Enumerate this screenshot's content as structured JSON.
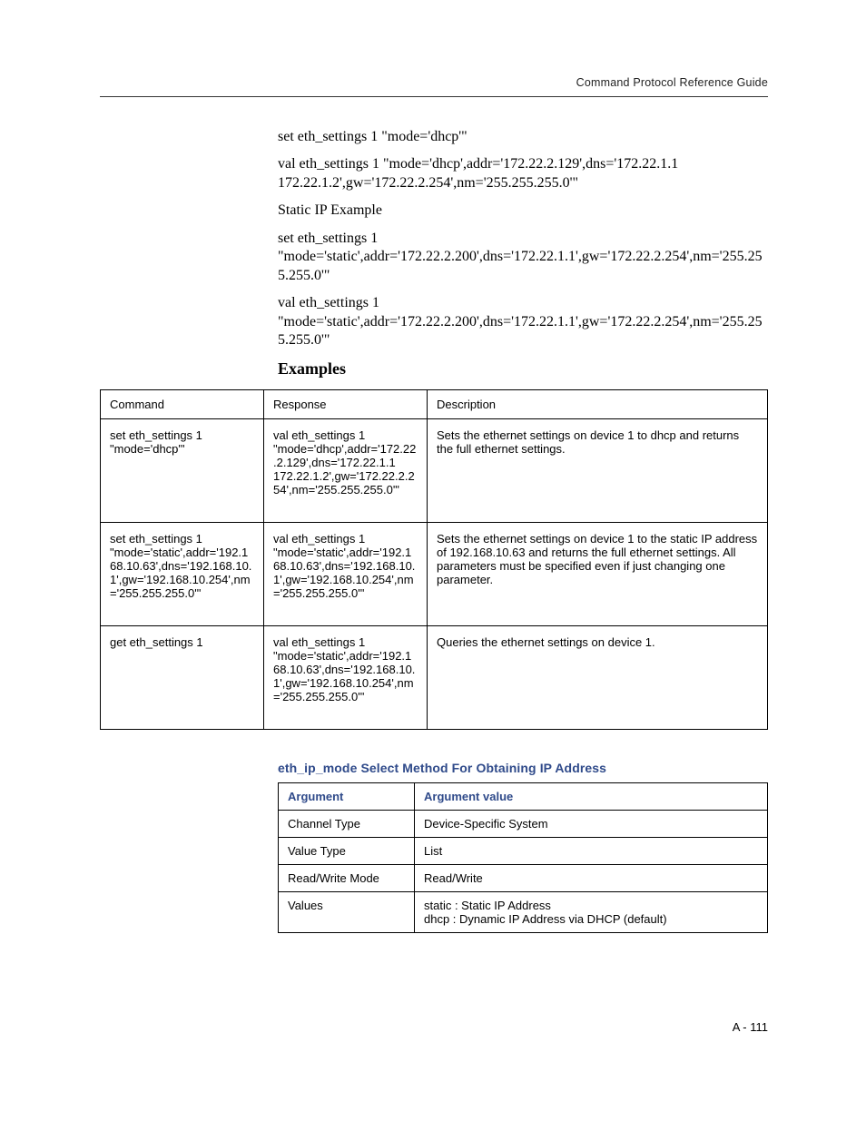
{
  "header": {
    "title": "Command Protocol Reference Guide"
  },
  "body": {
    "p1": "set eth_settings 1 \"mode='dhcp'\"",
    "p2": "val eth_settings 1 \"mode='dhcp',addr='172.22.2.129',dns='172.22.1.1 172.22.1.2',gw='172.22.2.254',nm='255.255.255.0'\"",
    "p3": "Static IP Example",
    "p4": "set eth_settings 1 \"mode='static',addr='172.22.2.200',dns='172.22.1.1',gw='172.22.2.254',nm='255.255.255.0'\"",
    "p5": "val eth_settings 1 \"mode='static',addr='172.22.2.200',dns='172.22.1.1',gw='172.22.2.254',nm='255.255.255.0'\""
  },
  "examples": {
    "heading": "Examples",
    "headers": {
      "c1": "Command",
      "c2": "Response",
      "c3": "Description"
    },
    "rows": [
      {
        "command": "set eth_settings 1 \"mode='dhcp'\"",
        "response": "val eth_settings 1 \"mode='dhcp',addr='172.22.2.129',dns='172.22.1.1 172.22.1.2',gw='172.22.2.254',nm='255.255.255.0'\"",
        "description": "Sets the ethernet settings on device 1 to dhcp and returns the full ethernet settings."
      },
      {
        "command": "set eth_settings 1 \"mode='static',addr='192.168.10.63',dns='192.168.10.1',gw='192.168.10.254',nm='255.255.255.0'\"",
        "response": "val eth_settings 1 \"mode='static',addr='192.168.10.63',dns='192.168.10.1',gw='192.168.10.254',nm='255.255.255.0'\"",
        "description": "Sets the ethernet settings on device 1 to the static IP address of 192.168.10.63 and returns the full ethernet settings. All parameters must be specified even if just changing one parameter."
      },
      {
        "command": "get eth_settings 1",
        "response": "val eth_settings 1 \"mode='static',addr='192.168.10.63',dns='192.168.10.1',gw='192.168.10.254',nm='255.255.255.0'\"",
        "description": "Queries the ethernet settings on device 1."
      }
    ]
  },
  "argSection": {
    "title": "eth_ip_mode Select Method For Obtaining IP Address",
    "headers": {
      "a1": "Argument",
      "a2": "Argument value"
    },
    "rows": [
      {
        "arg": "Channel Type",
        "val": "Device-Specific System"
      },
      {
        "arg": "Value Type",
        "val": "List"
      },
      {
        "arg": "Read/Write Mode",
        "val": "Read/Write"
      },
      {
        "arg": "Values",
        "val": "static : Static IP Address\ndhcp : Dynamic IP Address via DHCP (default)"
      }
    ]
  },
  "footer": {
    "pageNumber": "A - 111"
  }
}
